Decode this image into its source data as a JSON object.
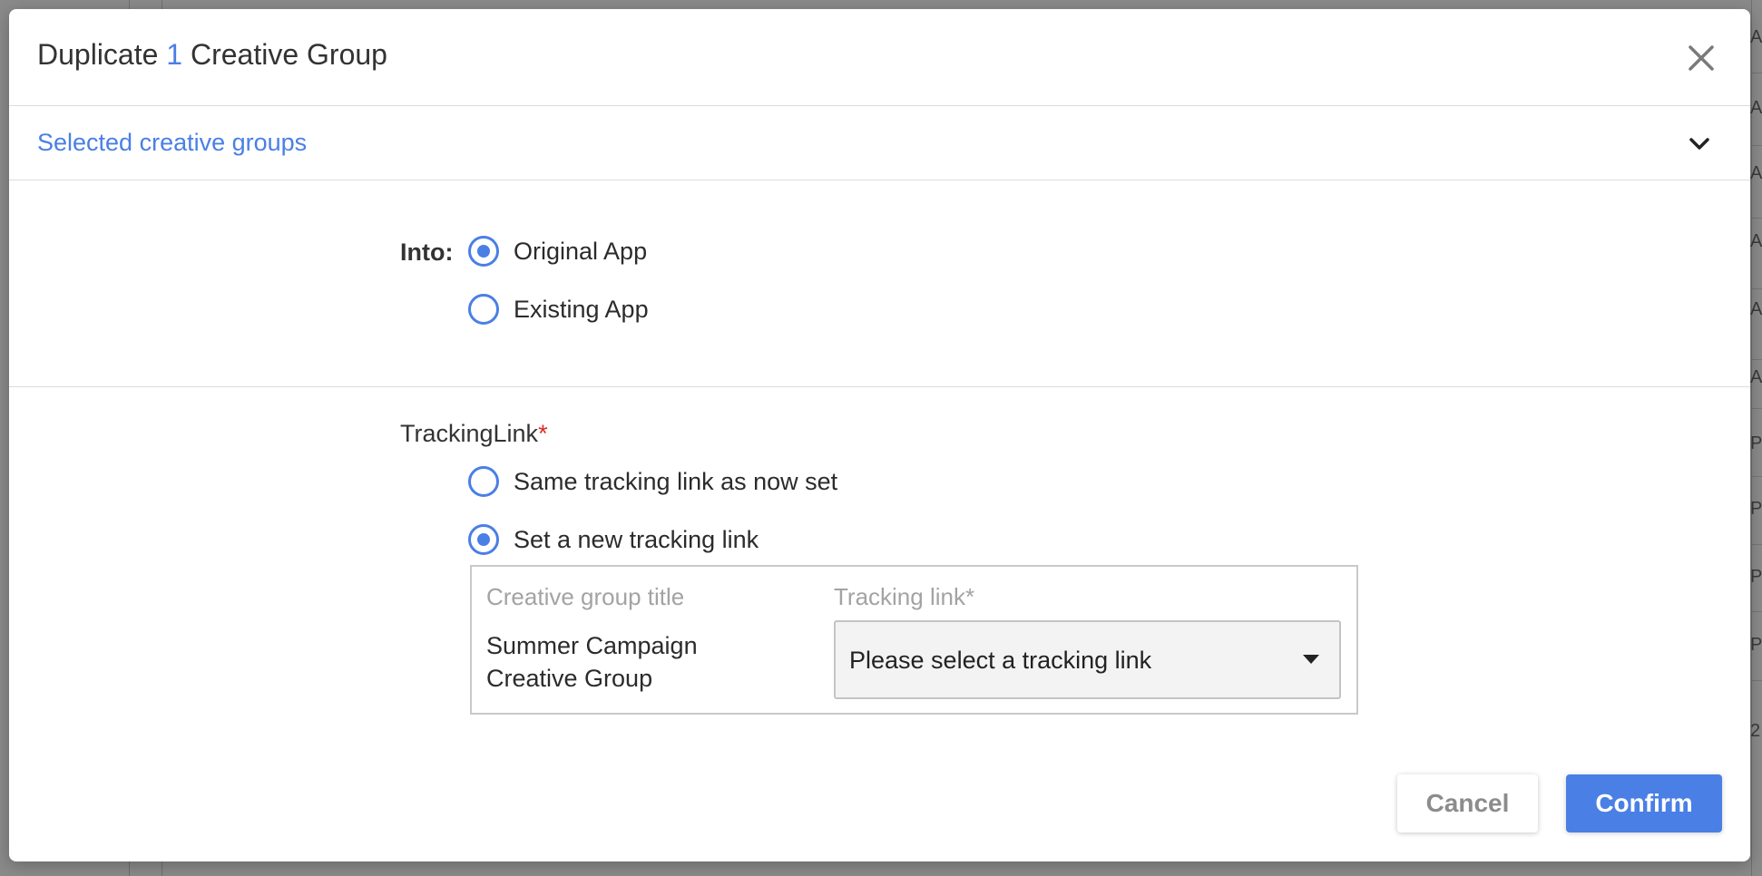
{
  "background": {
    "side_cells": [
      "Al",
      "AI",
      "A",
      "A",
      "Al",
      "A",
      "P",
      "P",
      "P",
      "P",
      "2"
    ]
  },
  "modal": {
    "title_prefix": "Duplicate",
    "title_count": "1",
    "title_suffix": "Creative Group",
    "close_icon": "close-icon"
  },
  "selected_section": {
    "label": "Selected creative groups",
    "toggle_icon": "chevron-down-icon"
  },
  "into": {
    "label": "Into:",
    "options": [
      {
        "label": "Original App",
        "checked": true
      },
      {
        "label": "Existing App",
        "checked": false
      }
    ]
  },
  "tracking": {
    "label": "TrackingLink",
    "required_mark": "*",
    "options": [
      {
        "label": "Same tracking link as now set",
        "checked": false
      },
      {
        "label": "Set a new tracking link",
        "checked": true
      }
    ],
    "table": {
      "col_title": "Creative group title",
      "col_link": "Tracking link*",
      "rows": [
        {
          "title": "Summer Campaign Creative Group",
          "select_value": "Please select a tracking link"
        }
      ]
    }
  },
  "footer": {
    "cancel_label": "Cancel",
    "confirm_label": "Confirm"
  },
  "colors": {
    "accent": "#4a7fe6",
    "required": "#e0291f",
    "muted": "#a3a3a3"
  }
}
